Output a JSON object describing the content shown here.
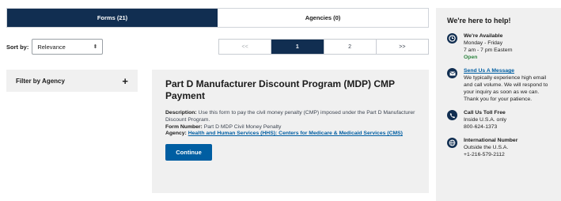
{
  "tabs": [
    {
      "label": "Forms (21)",
      "active": true
    },
    {
      "label": "Agencies (0)",
      "active": false
    }
  ],
  "sort": {
    "label": "Sort by:",
    "value": "Relevance"
  },
  "pagination": {
    "first": "<<",
    "pages": [
      "1",
      "2"
    ],
    "current": "1",
    "last": ">>"
  },
  "filter": {
    "label": "Filter by Agency",
    "toggle": "+"
  },
  "result": {
    "title": "Part D Manufacturer Discount Program (MDP) CMP Payment",
    "description_label": "Description:",
    "description": "Use this form to pay the civil money penalty (CMP) imposed under the Part D Manufacturer Discount Program.",
    "form_number_label": "Form Number:",
    "form_number": "Part D MDP Civil Money Penalty",
    "agency_label": "Agency:",
    "agency": "Health and Human Services (HHS): Centers for Medicare & Medicaid Services (CMS)",
    "button": "Continue"
  },
  "help": {
    "title": "We're here to help!",
    "available": {
      "heading": "We're Available",
      "days": "Monday - Friday",
      "hours": "7 am - 7 pm Eastern",
      "status": "Open",
      "icon": "clock-icon"
    },
    "message": {
      "link": "Send Us A Message",
      "text": "We typically experience high email and call volume. We will respond to your inquiry as soon as we can. Thank you for your patience.",
      "icon": "envelope-icon"
    },
    "tollfree": {
      "heading": "Call Us Toll Free",
      "line1": "Inside U.S.A. only",
      "number": "800-624-1373",
      "icon": "phone-icon"
    },
    "international": {
      "heading": "International Number",
      "line1": "Outside the U.S.A.",
      "number": "+1-216-579-2112",
      "icon": "globe-icon"
    }
  },
  "colors": {
    "navy": "#112e51",
    "link_blue": "#005ea2",
    "open_green": "#2e8540",
    "panel_gray": "#f0f0f0"
  }
}
